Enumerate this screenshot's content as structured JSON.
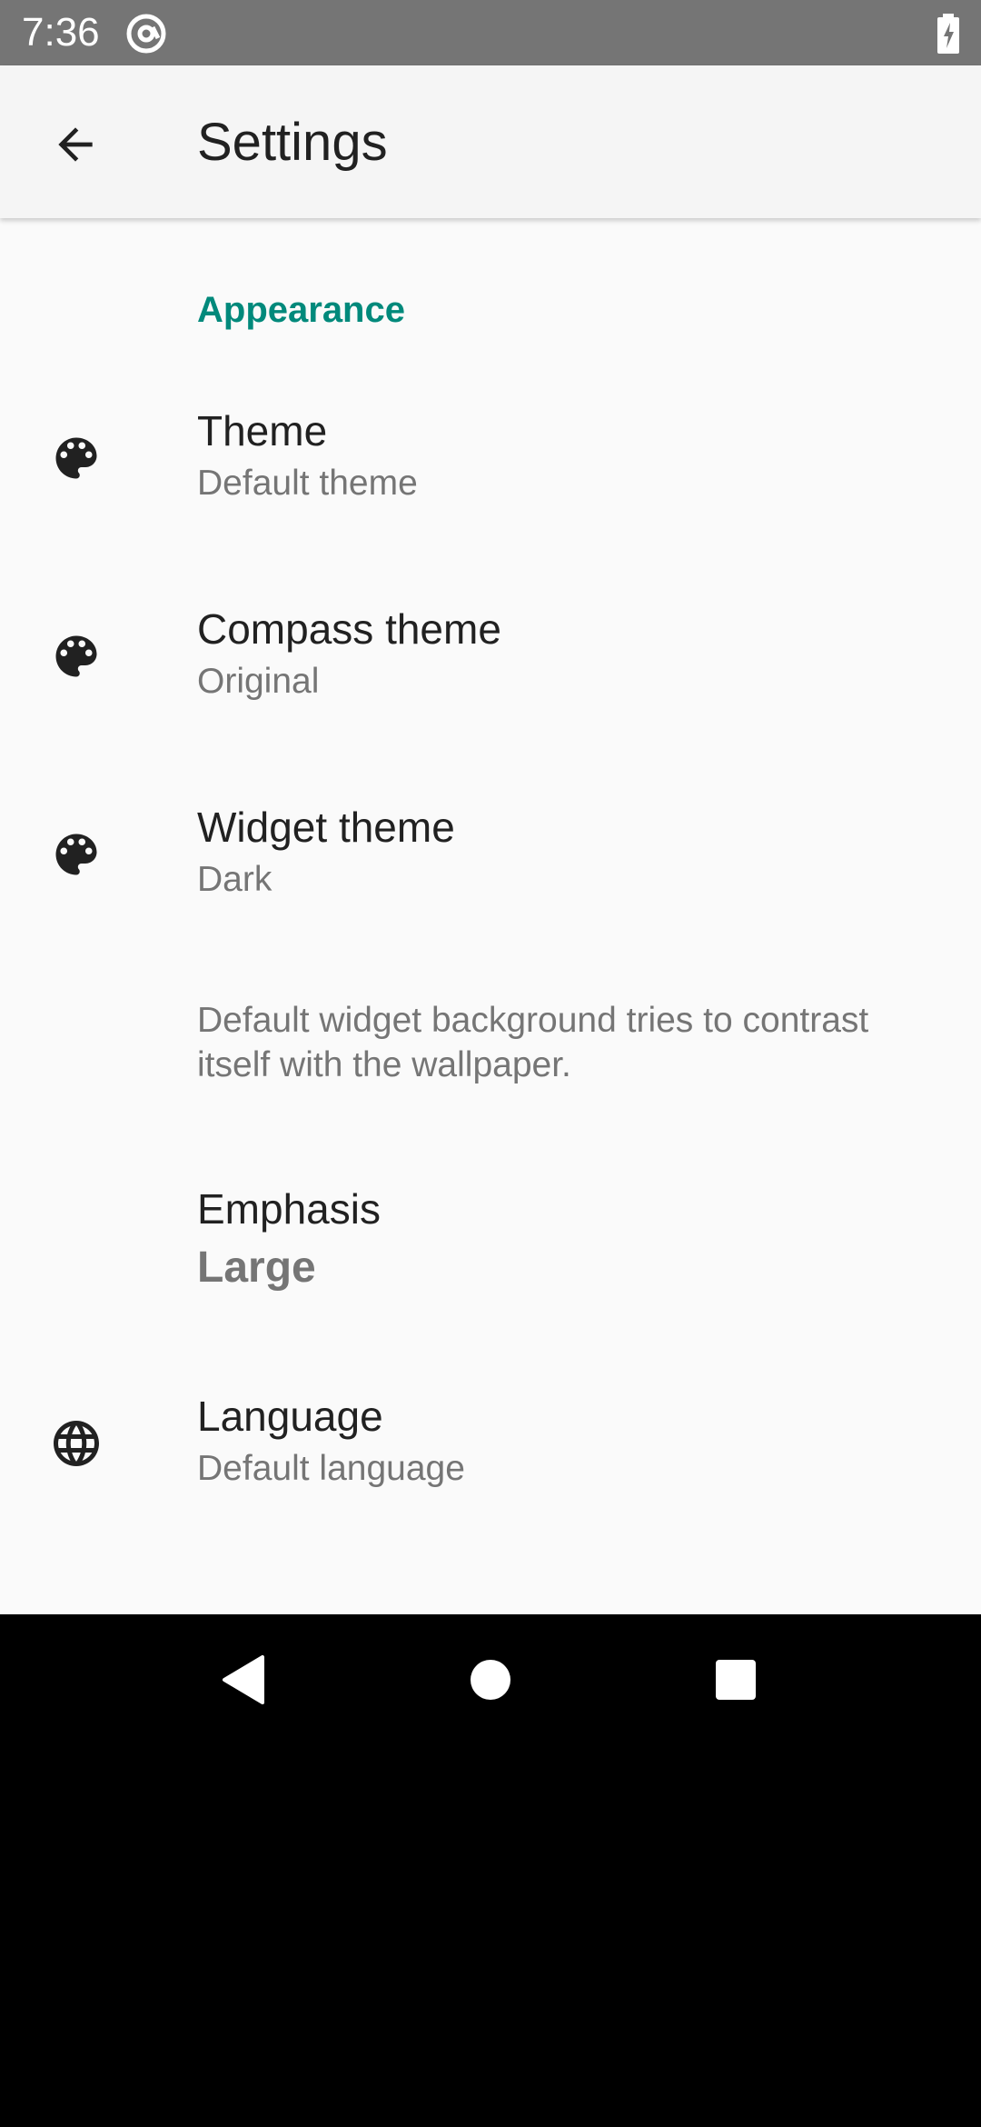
{
  "status_bar": {
    "time": "7:36",
    "app_icon": "at-sign-circle-icon",
    "battery_icon": "battery-charging-icon"
  },
  "app_bar": {
    "back_icon": "arrow-back-icon",
    "title": "Settings"
  },
  "sections": [
    {
      "header": "Appearance",
      "items": [
        {
          "icon": "palette-icon",
          "title": "Theme",
          "summary": "Default theme"
        },
        {
          "icon": "palette-icon",
          "title": "Compass theme",
          "summary": "Original"
        },
        {
          "icon": "palette-icon",
          "title": "Widget theme",
          "summary": "Dark"
        },
        {
          "note": "Default widget background tries to contrast itself with the wallpaper."
        },
        {
          "title": "Emphasis",
          "summary": "Large"
        },
        {
          "icon": "globe-icon",
          "title": "Language",
          "summary": "Default language"
        }
      ]
    }
  ],
  "nav_bar": {
    "back": "nav-back-icon",
    "home": "nav-home-icon",
    "recents": "nav-recents-icon"
  },
  "colors": {
    "accent": "#00897b",
    "status_bar": "#757575",
    "app_bar": "#f5f5f5",
    "background": "#fafafa"
  }
}
